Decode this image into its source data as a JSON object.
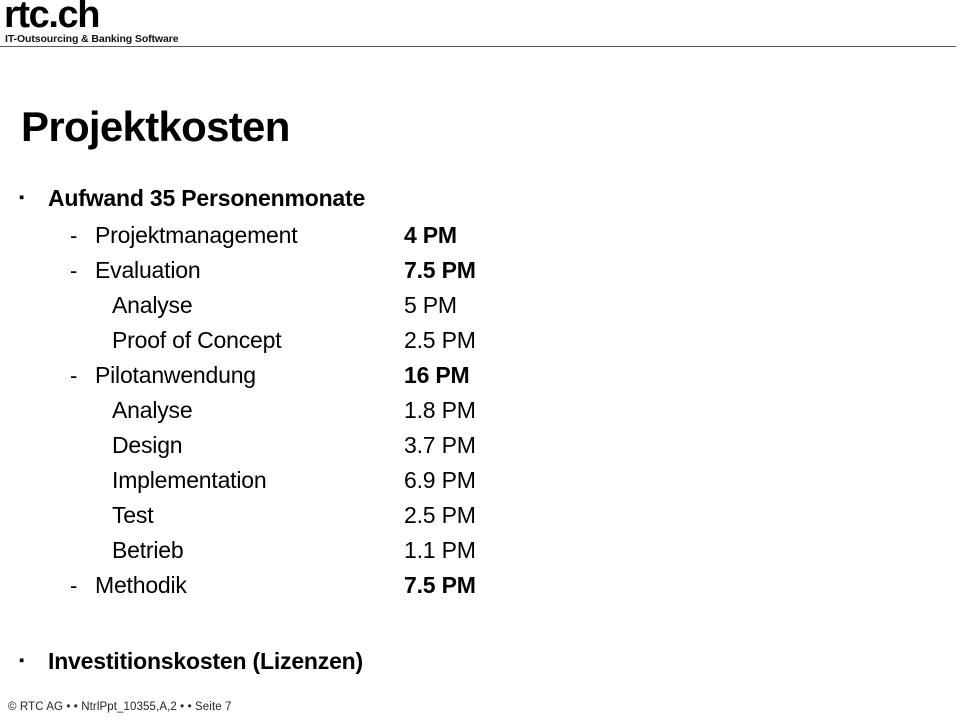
{
  "header": {
    "logo_wordmark": "rtc.ch",
    "logo_tagline": "IT-Outsourcing & Banking Software"
  },
  "title": "Projektkosten",
  "content": {
    "bullet_glyph": "▪",
    "dash_glyph": "-",
    "items": [
      {
        "level": 1,
        "label": "Aufwand 35 Personenmonate",
        "value": "",
        "value_bold": false
      },
      {
        "level": 2,
        "label": "Projektmanagement",
        "value": "4 PM",
        "value_bold": true
      },
      {
        "level": 2,
        "label": "Evaluation",
        "value": "7.5 PM",
        "value_bold": true
      },
      {
        "level": 3,
        "label": "Analyse",
        "value": "5 PM",
        "value_bold": false
      },
      {
        "level": 3,
        "label": "Proof of Concept",
        "value": "2.5 PM",
        "value_bold": false
      },
      {
        "level": 2,
        "label": "Pilotanwendung",
        "value": "16 PM",
        "value_bold": true
      },
      {
        "level": 3,
        "label": "Analyse",
        "value": "1.8 PM",
        "value_bold": false
      },
      {
        "level": 3,
        "label": "Design",
        "value": "3.7 PM",
        "value_bold": false
      },
      {
        "level": 3,
        "label": "Implementation",
        "value": "6.9 PM",
        "value_bold": false
      },
      {
        "level": 3,
        "label": "Test",
        "value": "2.5 PM",
        "value_bold": false
      },
      {
        "level": 3,
        "label": "Betrieb",
        "value": "1.1 PM",
        "value_bold": false
      },
      {
        "level": 2,
        "label": "Methodik",
        "value": "7.5 PM",
        "value_bold": true
      },
      {
        "level": 0,
        "label": "",
        "value": "",
        "value_bold": false
      },
      {
        "level": 1,
        "label": "Investitionskosten (Lizenzen)",
        "value": "",
        "value_bold": false
      }
    ]
  },
  "footer": {
    "text": "© RTC AG • • NtrlPpt_10355,A,2 • • Seite 7"
  },
  "colors": {
    "text": "#000000",
    "rule": "#5a5a5a",
    "footer_text": "#262626",
    "background": "#ffffff"
  }
}
